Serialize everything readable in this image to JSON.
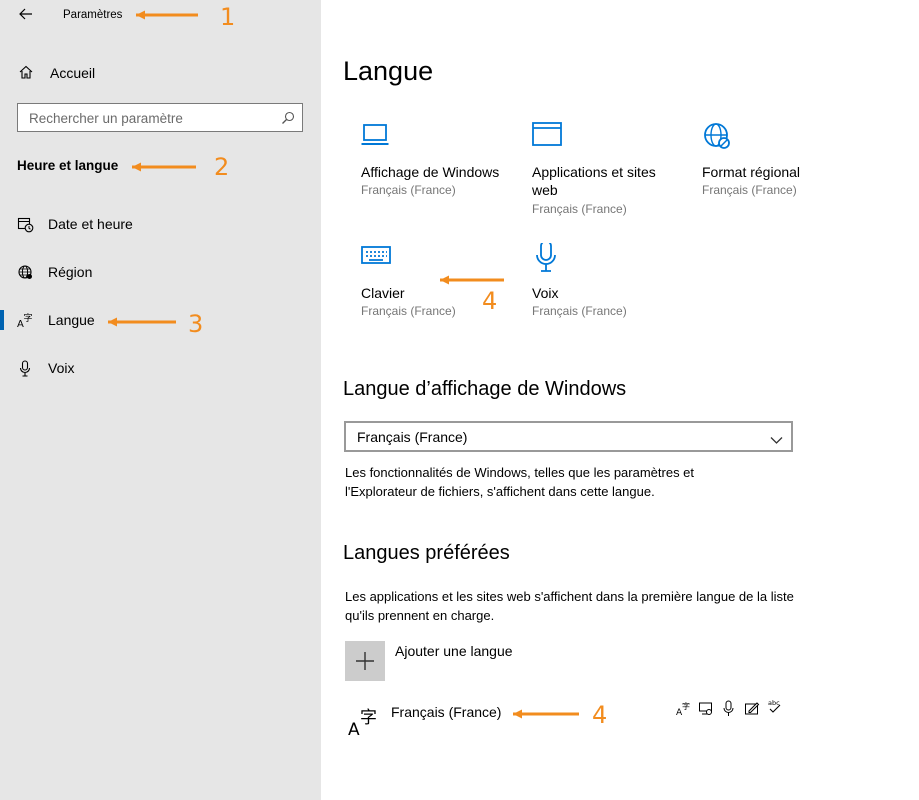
{
  "window": {
    "title": "Paramètres"
  },
  "sidebar": {
    "home_label": "Accueil",
    "search_placeholder": "Rechercher un paramètre",
    "section_title": "Heure et langue",
    "items": [
      {
        "label": "Date et heure",
        "icon": "date-time-icon"
      },
      {
        "label": "Région",
        "icon": "region-globe-icon"
      },
      {
        "label": "Langue",
        "icon": "language-icon",
        "active": true
      },
      {
        "label": "Voix",
        "icon": "microphone-icon"
      }
    ]
  },
  "main": {
    "title": "Langue",
    "tiles": [
      {
        "label": "Affichage de Windows",
        "sub": "Français (France)",
        "icon": "laptop-icon"
      },
      {
        "label": "Applications et sites web",
        "sub": "Français (France)",
        "icon": "window-icon"
      },
      {
        "label": "Format régional",
        "sub": "Français (France)",
        "icon": "globe-settings-icon"
      },
      {
        "label": "Clavier",
        "sub": "Français (France)",
        "icon": "keyboard-icon"
      },
      {
        "label": "Voix",
        "sub": "Français (France)",
        "icon": "microphone-icon"
      }
    ],
    "display_section": {
      "heading": "Langue d’affichage de Windows",
      "selected": "Français (France)",
      "description": "Les fonctionnalités de Windows, telles que les paramètres et l'Explorateur de fichiers, s'affichent dans cette langue."
    },
    "preferred_section": {
      "heading": "Langues préférées",
      "description": "Les applications et les sites web s'affichent dans la première langue de la liste qu'ils prennent en charge.",
      "add_label": "Ajouter une langue",
      "languages": [
        {
          "label": "Français (France)",
          "features": [
            "display-language-icon",
            "text-to-speech-icon",
            "speech-recognition-icon",
            "handwriting-icon",
            "spellcheck-icon"
          ]
        }
      ]
    }
  },
  "annotations": [
    "1",
    "2",
    "3",
    "4",
    "4"
  ],
  "colors": {
    "accent": "#0063b1",
    "icon_blue": "#0078d7",
    "sidebar_bg": "#e6e6e6",
    "annotation": "#f28c1e"
  }
}
